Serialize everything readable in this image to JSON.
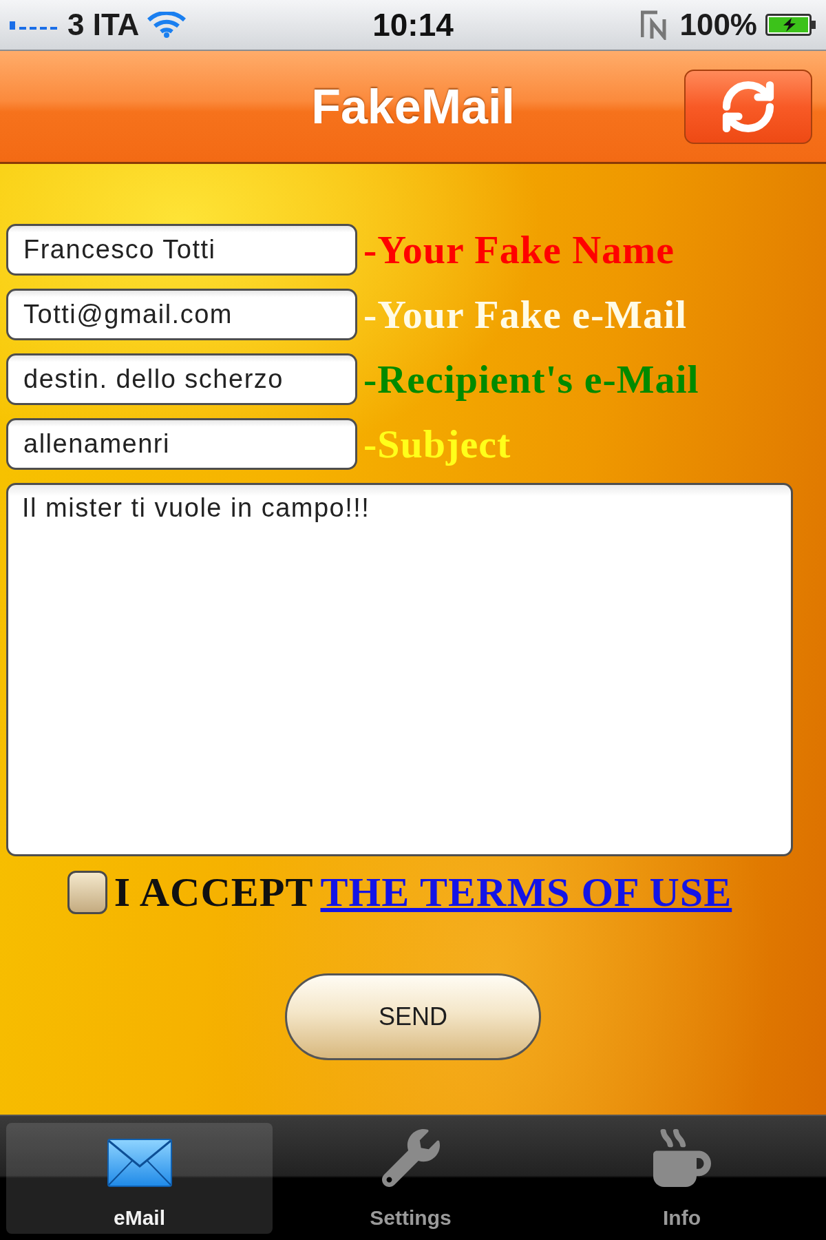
{
  "status_bar": {
    "carrier": "3 ITA",
    "time": "10:14",
    "battery": "100%"
  },
  "nav_bar": {
    "title": "FakeMail"
  },
  "fields": [
    {
      "value": "Francesco Totti",
      "label": "-Your Fake Name",
      "color": "#ff0000"
    },
    {
      "value": "Totti@gmail.com",
      "label": "-Your Fake e-Mail",
      "color": "#fffbe6"
    },
    {
      "value": "destin. dello scherzo",
      "label": "-Recipient's e-Mail",
      "color": "#008a00"
    },
    {
      "value": "allenamenri",
      "label": "-Subject",
      "color": "#ffff1a"
    }
  ],
  "message": {
    "value": "Il mister ti vuole in campo!!!"
  },
  "terms": {
    "checked": false,
    "text": "I ACCEPT",
    "link": "THE TERMS OF USE"
  },
  "send_button": {
    "label": "SEND"
  },
  "tabs": [
    {
      "label": "eMail",
      "selected": true
    },
    {
      "label": "Settings",
      "selected": false
    },
    {
      "label": "Info",
      "selected": false
    }
  ]
}
